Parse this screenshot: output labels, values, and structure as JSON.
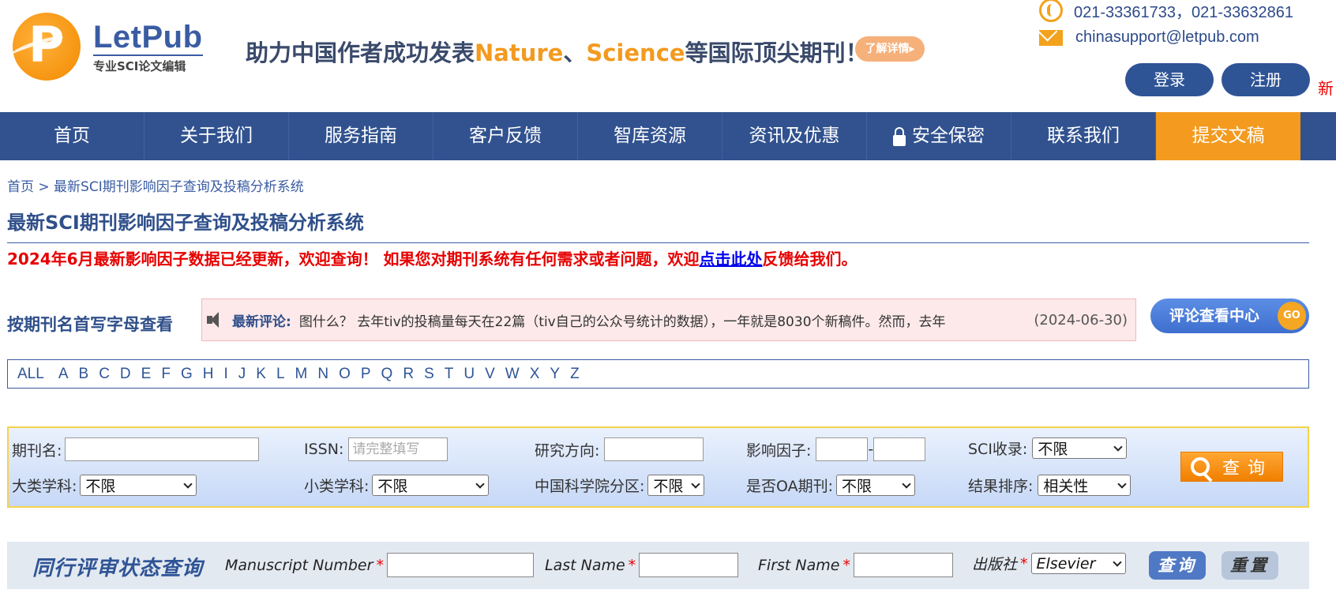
{
  "brand": {
    "name": "LetPub",
    "subtitle": "专业SCI论文编辑",
    "logo_letter": "P"
  },
  "slogan": {
    "part1": "助力中国作者成功发表",
    "highlight1": "Nature",
    "sep": "、",
    "highlight2": "Science",
    "part2": "等国际顶尖期刊！"
  },
  "learn_more": "了解详情▸",
  "contact": {
    "phone": "021-33361733，021-33632861",
    "email": "chinasupport@letpub.com"
  },
  "auth": {
    "login": "登录",
    "register": "注册",
    "side_text": "新"
  },
  "nav": [
    "首页",
    "关于我们",
    "服务指南",
    "客户反馈",
    "智库资源",
    "资讯及优惠",
    "安全保密",
    "联系我们",
    "提交文稿"
  ],
  "breadcrumb": "首页 > 最新SCI期刊影响因子查询及投稿分析系统",
  "page_title": "最新SCI期刊影响因子查询及投稿分析系统",
  "notice": {
    "text": "2024年6月最新影响因子数据已经更新，欢迎查询！ 如果您对期刊系统有任何需求或者问题，欢迎",
    "link": "点击此处",
    "tail": "反馈给我们。"
  },
  "letter_section_label": "按期刊名首写字母查看",
  "latest_comment": {
    "label": "最新评论:",
    "text": "图什么？ 去年tiv的投稿量每天在22篇（tiv自己的公众号统计的数据），一年就是8030个新稿件。然而，去年",
    "date": "(2024-06-30)"
  },
  "review_center": {
    "label": "评论查看中心",
    "go": "GO"
  },
  "alphabet": [
    "ALL",
    "A",
    "B",
    "C",
    "D",
    "E",
    "F",
    "G",
    "H",
    "I",
    "J",
    "K",
    "L",
    "M",
    "N",
    "O",
    "P",
    "Q",
    "R",
    "S",
    "T",
    "U",
    "V",
    "W",
    "X",
    "Y",
    "Z"
  ],
  "search": {
    "journal_name_label": "期刊名:",
    "issn_label": "ISSN:",
    "issn_placeholder": "请完整填写",
    "research_label": "研究方向:",
    "if_label": "影响因子:",
    "if_sep": "-",
    "sci_label": "SCI收录:",
    "sci_value": "不限",
    "major_label": "大类学科:",
    "major_value": "不限",
    "minor_label": "小类学科:",
    "minor_value": "不限",
    "cas_label": "中国科学院分区:",
    "cas_value": "不限",
    "oa_label": "是否OA期刊:",
    "oa_value": "不限",
    "sort_label": "结果排序:",
    "sort_value": "相关性",
    "button": "查询"
  },
  "peer_review": {
    "title": "同行评审状态查询",
    "manuscript_label": "Manuscript Number",
    "lastname_label": "Last Name",
    "firstname_label": "First Name",
    "publisher_label": "出版社",
    "publisher_value": "Elsevier",
    "required_mark": "*",
    "query_button": "查询",
    "reset_button": "重置"
  },
  "colors": {
    "primary": "#31528f",
    "accent": "#f39a1f",
    "alert": "#e60000"
  }
}
